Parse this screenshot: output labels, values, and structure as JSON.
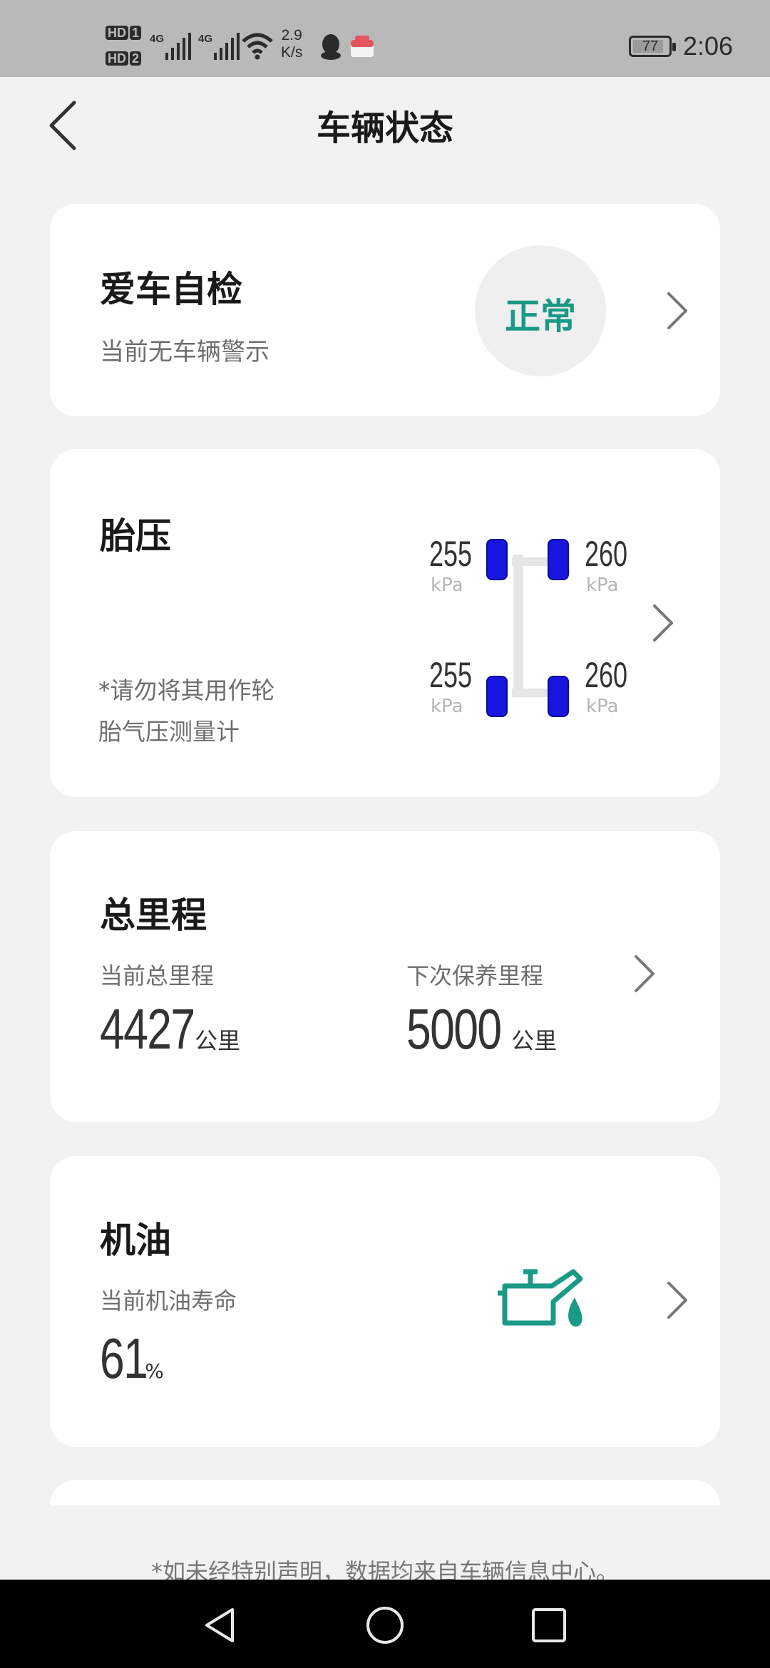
{
  "status_bar": {
    "hd1": "HD",
    "hd1_num": "1",
    "hd2": "HD",
    "hd2_num": "2",
    "net1": "4G",
    "net2": "4G",
    "speed_value": "2.9",
    "speed_unit": "K/s",
    "battery": "77",
    "time": "2:06"
  },
  "header": {
    "title": "车辆状态"
  },
  "self_check": {
    "title": "爱车自检",
    "subtitle": "当前无车辆警示",
    "status": "正常",
    "status_color": "#1a9a86"
  },
  "tire_pressure": {
    "title": "胎压",
    "note_line1": "*请勿将其用作轮",
    "note_line2": "胎气压测量计",
    "front_left": {
      "value": "255",
      "unit": "kPa"
    },
    "front_right": {
      "value": "260",
      "unit": "kPa"
    },
    "rear_left": {
      "value": "255",
      "unit": "kPa"
    },
    "rear_right": {
      "value": "260",
      "unit": "kPa"
    },
    "tire_color": "#1616e0"
  },
  "mileage": {
    "title": "总里程",
    "current_label": "当前总里程",
    "current_value": "4427",
    "current_unit": "公里",
    "next_label": "下次保养里程",
    "next_value": "5000",
    "next_unit": "公里"
  },
  "oil": {
    "title": "机油",
    "life_label": "当前机油寿命",
    "life_value": "61",
    "life_unit": "%",
    "icon_color": "#1a9a86"
  },
  "footer": {
    "note": "*如未经特别声明，数据均来自车辆信息中心。"
  }
}
